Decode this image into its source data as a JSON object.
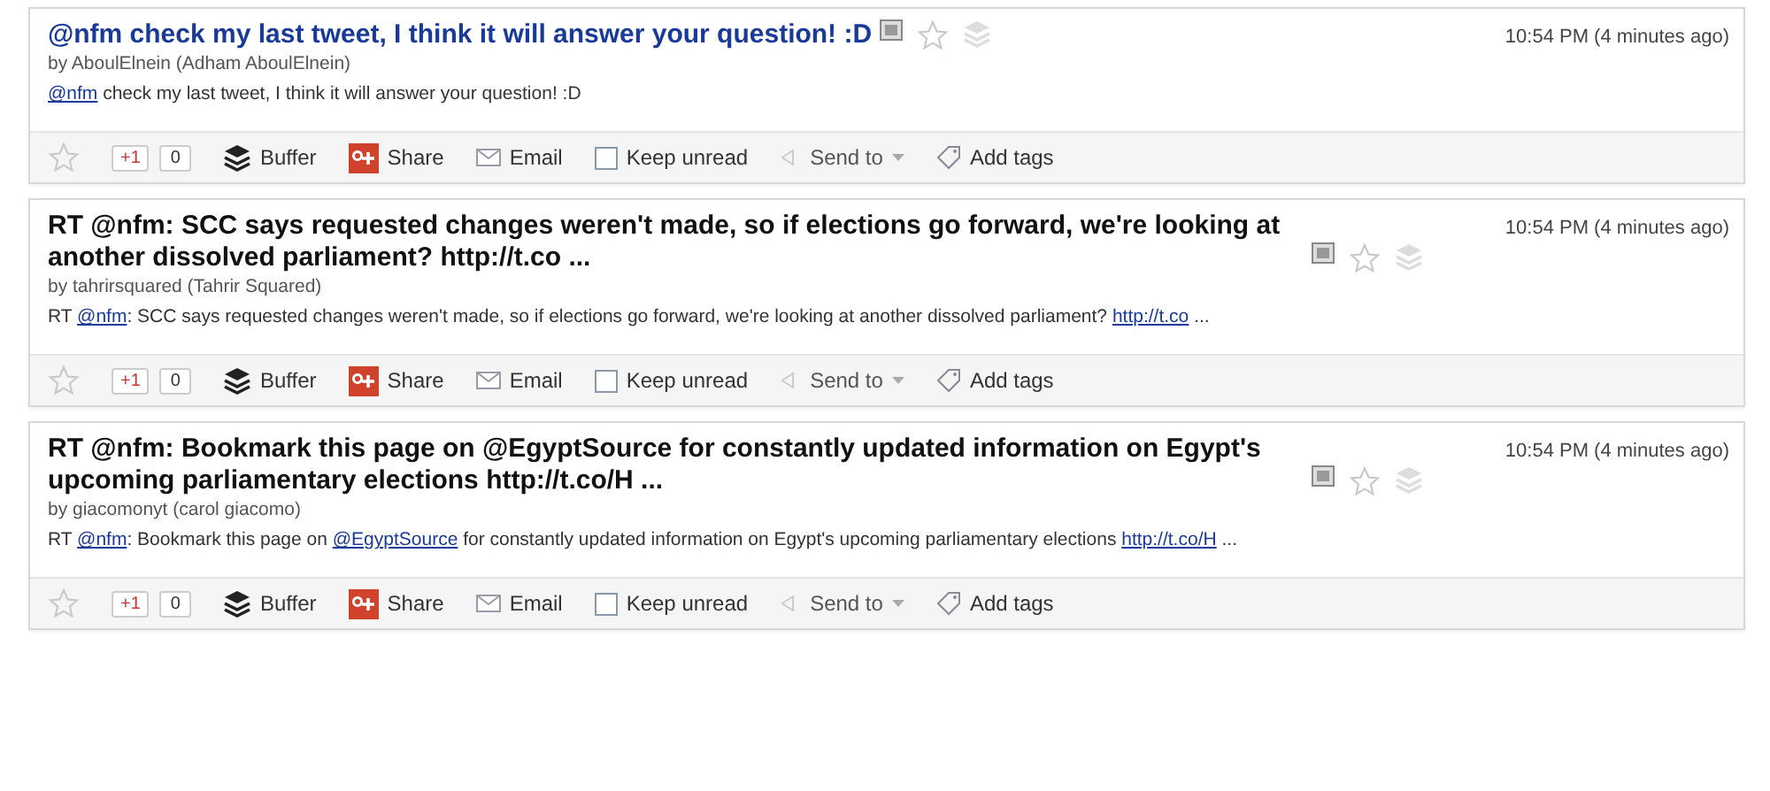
{
  "entries": [
    {
      "title": "@nfm check my last tweet, I think it will answer your question! :D",
      "selected": true,
      "author": "by AboulElnein (Adham AboulElnein)",
      "time": "10:54 PM (4 minutes ago)",
      "snippet": [
        {
          "kind": "link",
          "text": "@nfm"
        },
        {
          "kind": "text",
          "text": " check my last tweet, I think it will answer your question! :D"
        }
      ],
      "actions": {
        "plus_one": "+1",
        "count": "0",
        "buffer": "Buffer",
        "share": "Share",
        "email": "Email",
        "keep_unread": {
          "label": "Keep unread",
          "checked": false
        },
        "send_to": "Send to",
        "add_tags": "Add tags"
      }
    },
    {
      "title": "RT @nfm: SCC says requested changes weren't made, so if elections go forward, we're looking at another dissolved parliament? http://t.co ...",
      "selected": false,
      "author": "by tahrirsquared (Tahrir Squared)",
      "time": "10:54 PM (4 minutes ago)",
      "snippet": [
        {
          "kind": "text",
          "text": "RT "
        },
        {
          "kind": "link",
          "text": "@nfm"
        },
        {
          "kind": "text",
          "text": ": SCC says requested changes weren't made, so if elections go forward, we're looking at another dissolved parliament? "
        },
        {
          "kind": "link",
          "text": "http://t.co"
        },
        {
          "kind": "text",
          "text": " ..."
        }
      ],
      "actions": {
        "plus_one": "+1",
        "count": "0",
        "buffer": "Buffer",
        "share": "Share",
        "email": "Email",
        "keep_unread": {
          "label": "Keep unread",
          "checked": false
        },
        "send_to": "Send to",
        "add_tags": "Add tags"
      }
    },
    {
      "title": "RT @nfm: Bookmark this page on @EgyptSource for constantly updated information on Egypt's upcoming parliamentary elections http://t.co/H ...",
      "selected": false,
      "author": "by giacomonyt (carol giacomo)",
      "time": "10:54 PM (4 minutes ago)",
      "snippet": [
        {
          "kind": "text",
          "text": "RT "
        },
        {
          "kind": "link",
          "text": "@nfm"
        },
        {
          "kind": "text",
          "text": ": Bookmark this page on "
        },
        {
          "kind": "link",
          "text": "@EgyptSource"
        },
        {
          "kind": "text",
          "text": " for constantly updated information on Egypt's upcoming parliamentary elections "
        },
        {
          "kind": "link",
          "text": "http://t.co/H"
        },
        {
          "kind": "text",
          "text": " ..."
        }
      ],
      "actions": {
        "plus_one": "+1",
        "count": "0",
        "buffer": "Buffer",
        "share": "Share",
        "email": "Email",
        "keep_unread": {
          "label": "Keep unread",
          "checked": false
        },
        "send_to": "Send to",
        "add_tags": "Add tags"
      }
    }
  ]
}
